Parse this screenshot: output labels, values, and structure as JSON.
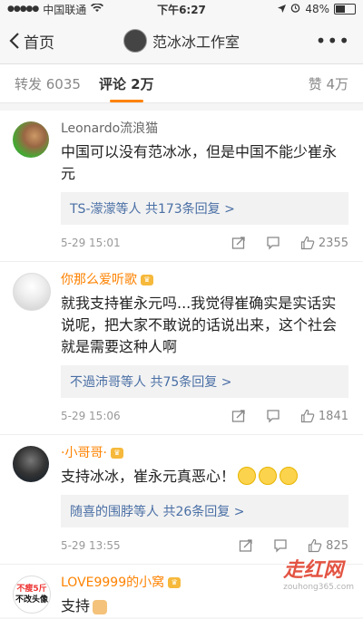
{
  "status": {
    "carrier": "中国联通",
    "time": "下午6:27",
    "battery": "48%"
  },
  "nav": {
    "back": "首页",
    "title": "范冰冰工作室",
    "more": "•••"
  },
  "tabs": [
    {
      "label": "转发 6035"
    },
    {
      "label": "评论 2万"
    },
    {
      "label": "赞 4万"
    }
  ],
  "comments": [
    {
      "name": "Leonardo流浪猫",
      "text": "中国可以没有范冰冰，但是中国不能少崔永元",
      "reply_user": "TS-濛濛等人",
      "reply_count": "共173条回复 >",
      "date": "5-29 15:01",
      "likes": "2355"
    },
    {
      "name": "你那么爱听歌",
      "text": "就我支持崔永元吗...我觉得崔确实是实话实说呢，把大家不敢说的话说出来，这个社会就是需要这种人啊",
      "reply_user": "不過沛哥等人",
      "reply_count": "共75条回复 >",
      "date": "5-29 15:06",
      "likes": "1841"
    },
    {
      "name": "·小哥哥·",
      "text": "支持冰冰，崔永元真恶心！",
      "reply_user": "随喜的围脖等人",
      "reply_count": "共26条回复 >",
      "date": "5-29 13:55",
      "likes": "825"
    },
    {
      "name": "LOVE9999的小窝",
      "text": "支持",
      "avatar_text_1": "不瘦5斤",
      "avatar_text_2": "不改头像"
    }
  ],
  "watermark": {
    "main": "走红网",
    "sub": "zouhong365.com"
  }
}
